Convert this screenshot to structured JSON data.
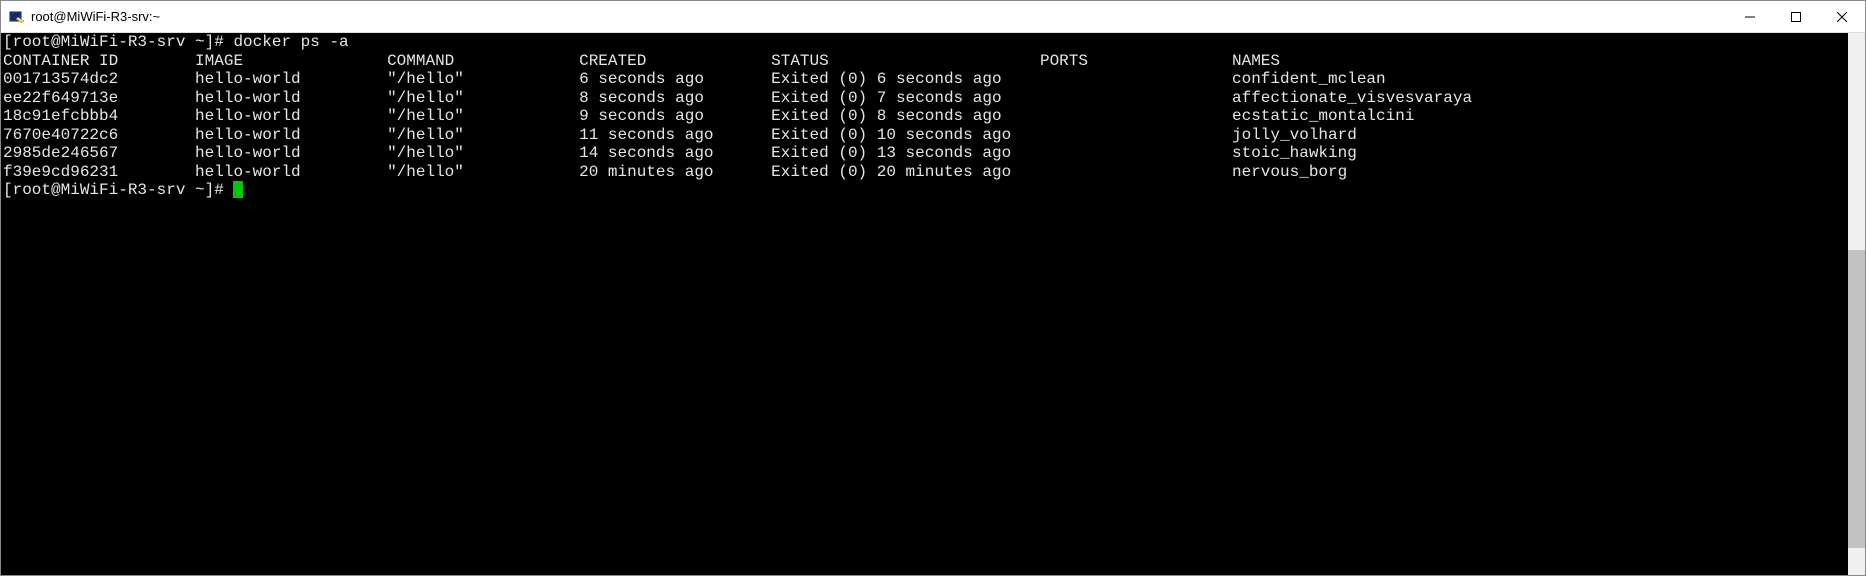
{
  "window": {
    "title": "root@MiWiFi-R3-srv:~"
  },
  "terminal": {
    "prompt": "[root@MiWiFi-R3-srv ~]# ",
    "command": "docker ps -a",
    "prompt2": "[root@MiWiFi-R3-srv ~]# ",
    "headers": {
      "container_id": "CONTAINER ID",
      "image": "IMAGE",
      "command": "COMMAND",
      "created": "CREATED",
      "status": "STATUS",
      "ports": "PORTS",
      "names": "NAMES"
    },
    "rows": [
      {
        "id": "001713574dc2",
        "image": "hello-world",
        "cmd": "\"/hello\"",
        "created": "6 seconds ago",
        "status": "Exited (0) 6 seconds ago",
        "ports": "",
        "names": "confident_mclean"
      },
      {
        "id": "ee22f649713e",
        "image": "hello-world",
        "cmd": "\"/hello\"",
        "created": "8 seconds ago",
        "status": "Exited (0) 7 seconds ago",
        "ports": "",
        "names": "affectionate_visvesvaraya"
      },
      {
        "id": "18c91efcbbb4",
        "image": "hello-world",
        "cmd": "\"/hello\"",
        "created": "9 seconds ago",
        "status": "Exited (0) 8 seconds ago",
        "ports": "",
        "names": "ecstatic_montalcini"
      },
      {
        "id": "7670e40722c6",
        "image": "hello-world",
        "cmd": "\"/hello\"",
        "created": "11 seconds ago",
        "status": "Exited (0) 10 seconds ago",
        "ports": "",
        "names": "jolly_volhard"
      },
      {
        "id": "2985de246567",
        "image": "hello-world",
        "cmd": "\"/hello\"",
        "created": "14 seconds ago",
        "status": "Exited (0) 13 seconds ago",
        "ports": "",
        "names": "stoic_hawking"
      },
      {
        "id": "f39e9cd96231",
        "image": "hello-world",
        "cmd": "\"/hello\"",
        "created": "20 minutes ago",
        "status": "Exited (0) 20 minutes ago",
        "ports": "",
        "names": "nervous_borg"
      }
    ]
  }
}
